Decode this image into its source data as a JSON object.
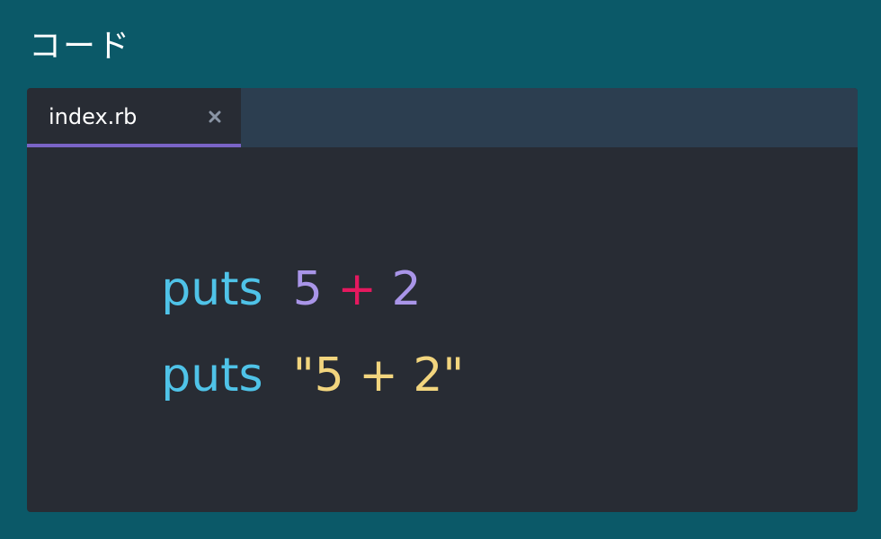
{
  "page": {
    "title": "コード"
  },
  "editor": {
    "tab": {
      "label": "index.rb",
      "close_icon": "close-icon"
    },
    "lines": [
      {
        "tokens": [
          {
            "text": "puts",
            "kind": "method",
            "color": "#4fc3e8"
          },
          {
            "text": "  ",
            "kind": "space",
            "color": "#ffffff"
          },
          {
            "text": "5",
            "kind": "number",
            "color": "#a995e8"
          },
          {
            "text": " ",
            "kind": "space",
            "color": "#ffffff"
          },
          {
            "text": "+",
            "kind": "operator",
            "color": "#e5195f"
          },
          {
            "text": " ",
            "kind": "space",
            "color": "#ffffff"
          },
          {
            "text": "2",
            "kind": "number",
            "color": "#a995e8"
          }
        ]
      },
      {
        "tokens": [
          {
            "text": "puts",
            "kind": "method",
            "color": "#4fc3e8"
          },
          {
            "text": "  ",
            "kind": "space",
            "color": "#ffffff"
          },
          {
            "text": "\"5 + 2\"",
            "kind": "string",
            "color": "#f2d57e"
          }
        ]
      }
    ]
  },
  "colors": {
    "background": "#0b5968",
    "editor_background": "#282c34",
    "tab_bar_background": "#2c3e50",
    "tab_active_underline": "#7a64c6"
  }
}
